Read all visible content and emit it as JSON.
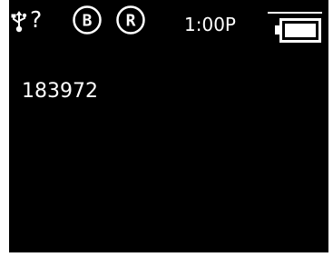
{
  "status_bar": {
    "usb_icon": "usb-icon",
    "unknown_indicator": "?",
    "badge_b": "B",
    "badge_r": "R",
    "time": "1:00P",
    "battery_icon": "battery-icon",
    "battery_level": 1.0
  },
  "main": {
    "code": "183972"
  },
  "colors": {
    "background": "#000000",
    "foreground": "#ffffff",
    "frame": "#ffffff"
  }
}
